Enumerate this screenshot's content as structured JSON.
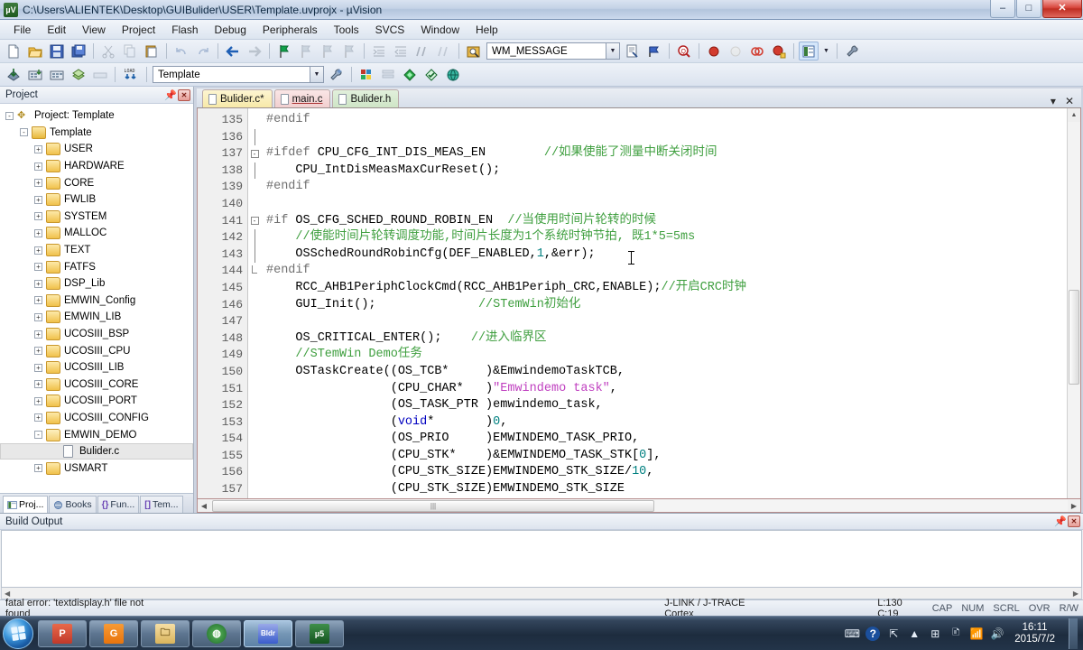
{
  "window": {
    "title": "C:\\Users\\ALIENTEK\\Desktop\\GUIBulider\\USER\\Template.uvprojx - µVision",
    "app_icon": "keil-uvision-icon",
    "minimize": "–",
    "maximize": "□",
    "close": "✕"
  },
  "menubar": {
    "items": [
      "File",
      "Edit",
      "View",
      "Project",
      "Flash",
      "Debug",
      "Peripherals",
      "Tools",
      "SVCS",
      "Window",
      "Help"
    ]
  },
  "toolbar_main": {
    "buttons": [
      {
        "name": "new-file-icon",
        "glyph": "📄"
      },
      {
        "name": "open-file-icon",
        "glyph": "📂"
      },
      {
        "name": "save-icon",
        "glyph": "💾"
      },
      {
        "name": "save-all-icon",
        "glyph": "🗂"
      },
      {
        "name": "cut-icon",
        "glyph": "✂"
      },
      {
        "name": "copy-icon",
        "glyph": "⧉"
      },
      {
        "name": "paste-icon",
        "glyph": "📋"
      },
      {
        "name": "undo-icon",
        "glyph": "↶"
      },
      {
        "name": "redo-icon",
        "glyph": "↷"
      },
      {
        "name": "navigate-back-icon",
        "glyph": "⬅"
      },
      {
        "name": "navigate-forward-icon",
        "glyph": "➡"
      },
      {
        "name": "bookmark-toggle-icon",
        "glyph": "⚑"
      },
      {
        "name": "bookmark-prev-icon",
        "glyph": "⚐"
      },
      {
        "name": "bookmark-next-icon",
        "glyph": "⚐"
      },
      {
        "name": "bookmark-clear-icon",
        "glyph": "⚐"
      },
      {
        "name": "indent-icon",
        "glyph": "⇥"
      },
      {
        "name": "outdent-icon",
        "glyph": "⇤"
      },
      {
        "name": "comment-icon",
        "glyph": "//"
      },
      {
        "name": "uncomment-icon",
        "glyph": "//"
      },
      {
        "name": "find-in-files-icon",
        "glyph": "🔎"
      }
    ],
    "search_value": "WM_MESSAGE",
    "search_placeholder": "",
    "after_buttons": [
      {
        "name": "find-icon",
        "glyph": "🔍"
      },
      {
        "name": "bookmark-flag-icon",
        "glyph": "🔖"
      },
      {
        "name": "find-replace-icon",
        "glyph": "Q"
      },
      {
        "name": "breakpoint-insert-icon",
        "glyph": "●"
      },
      {
        "name": "breakpoint-disable-icon",
        "glyph": "○"
      },
      {
        "name": "breakpoint-kill-all-icon",
        "glyph": "◌"
      },
      {
        "name": "breakpoint-disable-all-icon",
        "glyph": "◐"
      },
      {
        "name": "manage-windows-icon",
        "glyph": "▤"
      },
      {
        "name": "configuration-wizard-icon",
        "glyph": "🔧"
      }
    ]
  },
  "toolbar_build": {
    "buttons": [
      {
        "name": "translate-icon",
        "glyph": "⬓"
      },
      {
        "name": "build-icon",
        "glyph": "▦"
      },
      {
        "name": "rebuild-icon",
        "glyph": "▩"
      },
      {
        "name": "batch-build-icon",
        "glyph": "❖"
      },
      {
        "name": "stop-build-icon",
        "glyph": "▭"
      },
      {
        "name": "download-icon",
        "glyph": "LOAD"
      }
    ],
    "target_value": "Template",
    "after_buttons": [
      {
        "name": "target-options-icon",
        "glyph": "🛠"
      },
      {
        "name": "manage-project-items-icon",
        "glyph": "⛁"
      },
      {
        "name": "manage-components-icon",
        "glyph": "▤"
      },
      {
        "name": "pack-installer-icon",
        "glyph": "◆"
      },
      {
        "name": "select-software-packs-icon",
        "glyph": "◇"
      },
      {
        "name": "manage-run-time-env-icon",
        "glyph": "◈"
      }
    ]
  },
  "project_panel": {
    "title": "Project",
    "pin_icon": "pin-icon",
    "close_icon": "close-icon",
    "tree": [
      {
        "label": "Project: Template",
        "depth": 0,
        "expander": "-",
        "icon": "project-icon"
      },
      {
        "label": "Template",
        "depth": 1,
        "expander": "-",
        "icon": "target-icon"
      },
      {
        "label": "USER",
        "depth": 2,
        "expander": "+",
        "icon": "folder-icon"
      },
      {
        "label": "HARDWARE",
        "depth": 2,
        "expander": "+",
        "icon": "folder-icon"
      },
      {
        "label": "CORE",
        "depth": 2,
        "expander": "+",
        "icon": "folder-icon"
      },
      {
        "label": "FWLIB",
        "depth": 2,
        "expander": "+",
        "icon": "folder-icon"
      },
      {
        "label": "SYSTEM",
        "depth": 2,
        "expander": "+",
        "icon": "folder-icon"
      },
      {
        "label": "MALLOC",
        "depth": 2,
        "expander": "+",
        "icon": "folder-icon"
      },
      {
        "label": "TEXT",
        "depth": 2,
        "expander": "+",
        "icon": "folder-icon"
      },
      {
        "label": "FATFS",
        "depth": 2,
        "expander": "+",
        "icon": "folder-icon"
      },
      {
        "label": "DSP_Lib",
        "depth": 2,
        "expander": "+",
        "icon": "folder-icon"
      },
      {
        "label": "EMWIN_Config",
        "depth": 2,
        "expander": "+",
        "icon": "folder-icon"
      },
      {
        "label": "EMWIN_LIB",
        "depth": 2,
        "expander": "+",
        "icon": "folder-icon"
      },
      {
        "label": "UCOSIII_BSP",
        "depth": 2,
        "expander": "+",
        "icon": "folder-icon"
      },
      {
        "label": "UCOSIII_CPU",
        "depth": 2,
        "expander": "+",
        "icon": "folder-icon"
      },
      {
        "label": "UCOSIII_LIB",
        "depth": 2,
        "expander": "+",
        "icon": "folder-icon"
      },
      {
        "label": "UCOSIII_CORE",
        "depth": 2,
        "expander": "+",
        "icon": "folder-icon"
      },
      {
        "label": "UCOSIII_PORT",
        "depth": 2,
        "expander": "+",
        "icon": "folder-icon"
      },
      {
        "label": "UCOSIII_CONFIG",
        "depth": 2,
        "expander": "+",
        "icon": "folder-icon"
      },
      {
        "label": "EMWIN_DEMO",
        "depth": 2,
        "expander": "-",
        "icon": "folder-open-icon"
      },
      {
        "label": "Bulider.c",
        "depth": 3,
        "expander": "",
        "icon": "c-file-icon",
        "selected": true
      },
      {
        "label": "USMART",
        "depth": 2,
        "expander": "+",
        "icon": "folder-icon"
      }
    ],
    "tabs": [
      {
        "label": "Proj...",
        "icon": "project-tab-icon",
        "active": true
      },
      {
        "label": "Books",
        "icon": "books-tab-icon",
        "active": false
      },
      {
        "label": "Fun...",
        "icon": "functions-tab-icon",
        "active": false
      },
      {
        "label": "Tem...",
        "icon": "templates-tab-icon",
        "active": false
      }
    ]
  },
  "editor": {
    "tabs": [
      {
        "label": "Bulider.c*",
        "color": "yellow",
        "active": true
      },
      {
        "label": "main.c",
        "color": "pink",
        "active": false
      },
      {
        "label": "Bulider.h",
        "color": "green",
        "active": false
      }
    ],
    "tab_menu_icon": "chevron-down-icon",
    "tab_close_icon": "close-icon",
    "first_line": 135,
    "lines": [
      {
        "n": 135,
        "fold": "",
        "segs": [
          {
            "t": "#endif",
            "c": "pp"
          }
        ]
      },
      {
        "n": 136,
        "fold": "line",
        "segs": []
      },
      {
        "n": 137,
        "fold": "minus",
        "segs": [
          {
            "t": "#ifdef",
            "c": "pp"
          },
          {
            "t": " CPU_CFG_INT_DIS_MEAS_EN        ",
            "c": ""
          },
          {
            "t": "//如果使能了测量中断关闭时间",
            "c": "cmt"
          }
        ]
      },
      {
        "n": 138,
        "fold": "line",
        "segs": [
          {
            "t": "    CPU_IntDisMeasMaxCurReset();",
            "c": ""
          }
        ]
      },
      {
        "n": 139,
        "fold": "",
        "segs": [
          {
            "t": "#endif",
            "c": "pp"
          }
        ]
      },
      {
        "n": 140,
        "fold": "",
        "segs": []
      },
      {
        "n": 141,
        "fold": "minus",
        "segs": [
          {
            "t": "#if",
            "c": "pp"
          },
          {
            "t": " OS_CFG_SCHED_ROUND_ROBIN_EN  ",
            "c": ""
          },
          {
            "t": "//当使用时间片轮转的时候",
            "c": "cmt"
          }
        ]
      },
      {
        "n": 142,
        "fold": "line",
        "segs": [
          {
            "t": "    ",
            "c": ""
          },
          {
            "t": "//使能时间片轮转调度功能,时间片长度为1个系统时钟节拍, 既1*5=5ms",
            "c": "cmt"
          }
        ]
      },
      {
        "n": 143,
        "fold": "line",
        "segs": [
          {
            "t": "    OSSchedRoundRobinCfg(DEF_ENABLED,",
            "c": ""
          },
          {
            "t": "1",
            "c": "num"
          },
          {
            "t": ",&err);",
            "c": ""
          }
        ]
      },
      {
        "n": 144,
        "fold": "end",
        "segs": [
          {
            "t": "#endif",
            "c": "pp"
          }
        ]
      },
      {
        "n": 145,
        "fold": "",
        "segs": [
          {
            "t": "    RCC_AHB1PeriphClockCmd(RCC_AHB1Periph_CRC,ENABLE);",
            "c": ""
          },
          {
            "t": "//开启CRC时钟",
            "c": "cmt"
          }
        ]
      },
      {
        "n": 146,
        "fold": "",
        "segs": [
          {
            "t": "    GUI_Init();              ",
            "c": ""
          },
          {
            "t": "//STemWin初始化",
            "c": "cmt"
          }
        ]
      },
      {
        "n": 147,
        "fold": "",
        "segs": []
      },
      {
        "n": 148,
        "fold": "",
        "segs": [
          {
            "t": "    OS_CRITICAL_ENTER();    ",
            "c": ""
          },
          {
            "t": "//进入临界区",
            "c": "cmt"
          }
        ]
      },
      {
        "n": 149,
        "fold": "",
        "segs": [
          {
            "t": "    ",
            "c": ""
          },
          {
            "t": "//STemWin Demo任务",
            "c": "cmt"
          }
        ]
      },
      {
        "n": 150,
        "fold": "",
        "segs": [
          {
            "t": "    OSTaskCreate((OS_TCB*     )&EmwindemoTaskTCB,",
            "c": ""
          }
        ]
      },
      {
        "n": 151,
        "fold": "",
        "segs": [
          {
            "t": "                 (CPU_CHAR*   )",
            "c": ""
          },
          {
            "t": "\"Emwindemo task\"",
            "c": "str"
          },
          {
            "t": ",",
            "c": ""
          }
        ]
      },
      {
        "n": 152,
        "fold": "",
        "segs": [
          {
            "t": "                 (OS_TASK_PTR )emwindemo_task,",
            "c": ""
          }
        ]
      },
      {
        "n": 153,
        "fold": "",
        "segs": [
          {
            "t": "                 (",
            "c": ""
          },
          {
            "t": "void",
            "c": "kw"
          },
          {
            "t": "*       )",
            "c": ""
          },
          {
            "t": "0",
            "c": "num"
          },
          {
            "t": ",",
            "c": ""
          }
        ]
      },
      {
        "n": 154,
        "fold": "",
        "segs": [
          {
            "t": "                 (OS_PRIO     )EMWINDEMO_TASK_PRIO,",
            "c": ""
          }
        ]
      },
      {
        "n": 155,
        "fold": "",
        "segs": [
          {
            "t": "                 (CPU_STK*    )&EMWINDEMO_TASK_STK[",
            "c": ""
          },
          {
            "t": "0",
            "c": "num"
          },
          {
            "t": "],",
            "c": ""
          }
        ]
      },
      {
        "n": 156,
        "fold": "",
        "segs": [
          {
            "t": "                 (CPU_STK_SIZE)EMWINDEMO_STK_SIZE/",
            "c": ""
          },
          {
            "t": "10",
            "c": "num"
          },
          {
            "t": ",",
            "c": ""
          }
        ]
      },
      {
        "n": 157,
        "fold": "",
        "segs": [
          {
            "t": "                 (CPU_STK_SIZE)EMWINDEMO_STK_SIZE",
            "c": ""
          }
        ]
      }
    ]
  },
  "build_output": {
    "title": "Build Output",
    "pin_icon": "pin-icon",
    "close_icon": "close-icon",
    "content": ""
  },
  "statusbar": {
    "message": "fatal error: 'textdisplay.h' file not found",
    "debugger": "J-LINK / J-TRACE Cortex",
    "cursor": "L:130 C:19",
    "flags": [
      "CAP",
      "NUM",
      "SCRL",
      "OVR",
      "R/W"
    ]
  },
  "taskbar": {
    "start_icon": "windows-start-icon",
    "items": [
      {
        "name": "taskbar-powerpoint",
        "glyph": "P",
        "color": "#d04423",
        "active": false
      },
      {
        "name": "taskbar-pdf-reader",
        "glyph": "G",
        "color": "#f07a17",
        "active": false
      },
      {
        "name": "taskbar-file-explorer",
        "glyph": "🗂",
        "color": "#e8c16a",
        "active": false
      },
      {
        "name": "taskbar-green-browser",
        "glyph": "◍",
        "color": "#2f7a2f",
        "active": false
      },
      {
        "name": "taskbar-builder",
        "glyph": "B",
        "color": "#3a5ccc",
        "active": true
      },
      {
        "name": "taskbar-keil-uvision",
        "glyph": "µ5",
        "color": "#1f6b2d",
        "active": false
      }
    ],
    "tray": [
      {
        "name": "keyboard-layout-icon",
        "glyph": "⌨"
      },
      {
        "name": "help-icon",
        "glyph": "?"
      },
      {
        "name": "tray-overflow-icon",
        "glyph": "⏷"
      },
      {
        "name": "show-hidden-icons-icon",
        "glyph": "▲"
      },
      {
        "name": "windows-logo-icon",
        "glyph": "⊞"
      },
      {
        "name": "action-center-icon",
        "glyph": "🗈"
      },
      {
        "name": "network-icon",
        "glyph": "📶"
      },
      {
        "name": "volume-icon",
        "glyph": "🔊"
      }
    ],
    "clock_time": "16:11",
    "clock_date": "2015/7/2"
  }
}
